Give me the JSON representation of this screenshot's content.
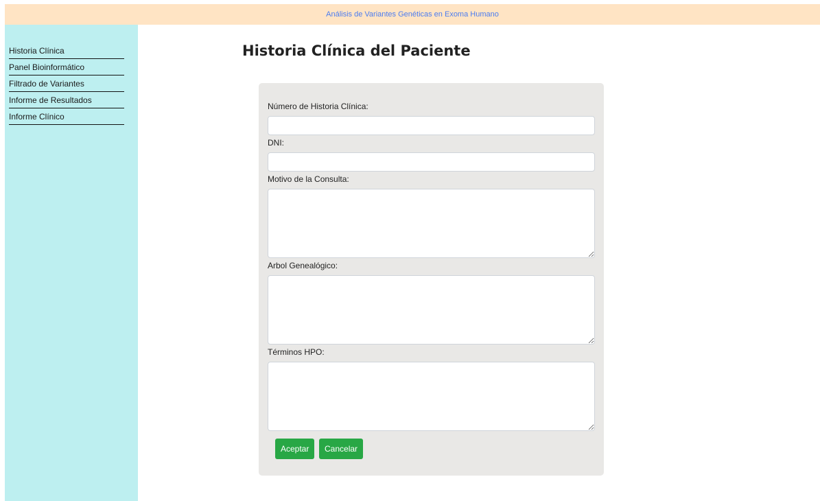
{
  "header": {
    "title": "Análisis de Variantes Genéticas en Exoma Humano"
  },
  "sidebar": {
    "items": [
      {
        "label": "Historia Clínica"
      },
      {
        "label": "Panel Bioinformático"
      },
      {
        "label": "Filtrado de Variantes"
      },
      {
        "label": "Informe de Resultados"
      },
      {
        "label": "Informe Clínico"
      }
    ]
  },
  "main": {
    "title": "Historia Clínica del Paciente"
  },
  "form": {
    "fields": [
      {
        "label": "Número de Historia Clínica:",
        "value": ""
      },
      {
        "label": "DNI:",
        "value": ""
      },
      {
        "label": "Motivo de la Consulta:",
        "value": ""
      },
      {
        "label": "Arbol Genealógico:",
        "value": ""
      },
      {
        "label": "Términos HPO:",
        "value": ""
      }
    ],
    "buttons": {
      "accept": "Aceptar",
      "cancel": "Cancelar"
    }
  },
  "colors": {
    "header_bg": "#ffe4c4",
    "header_text": "#4a7cf0",
    "sidebar_bg": "#bdeff0",
    "card_bg": "#e9e8e6",
    "button_bg": "#28a745"
  }
}
